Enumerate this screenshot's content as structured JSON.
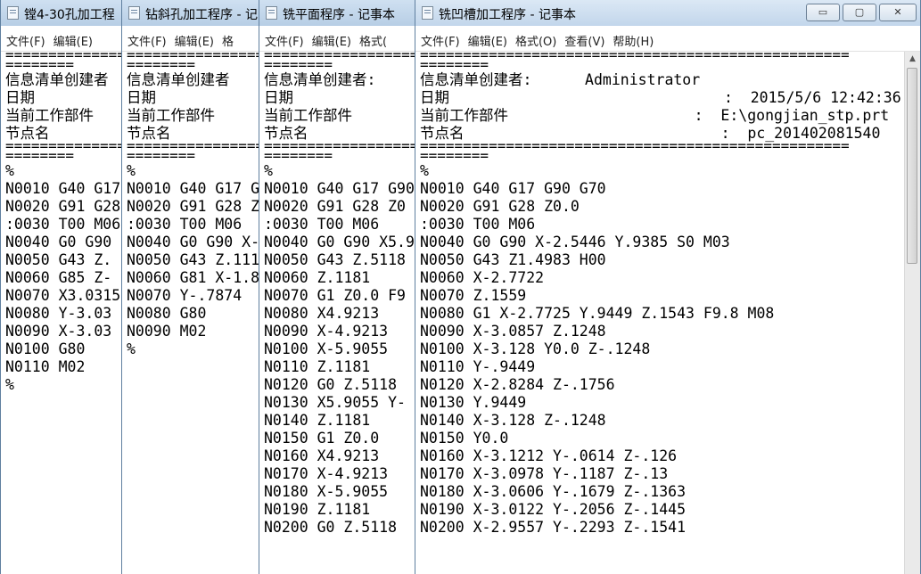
{
  "windows": [
    {
      "title": "镗4-30孔加工程",
      "menu": [
        "文件(F)",
        "编辑(E)"
      ],
      "lines": [
        "==============",
        "========",
        "信息清单创建者",
        "日期",
        "当前工作部件",
        "节点名",
        "==============",
        "========",
        "%",
        "N0010 G40 G17",
        "N0020 G91 G28",
        ":0030 T00 M06",
        "N0040 G0 G90",
        "N0050 G43 Z.",
        "N0060 G85 Z-",
        "N0070 X3.0315",
        "N0080 Y-3.03",
        "N0090 X-3.03",
        "N0100 G80",
        "N0110 M02",
        "%"
      ]
    },
    {
      "title": "钻斜孔加工程序 - 记",
      "menu": [
        "文件(F)",
        "编辑(E)",
        "格"
      ],
      "lines": [
        "====================",
        "========",
        "信息清单创建者",
        "日期",
        "当前工作部件",
        "节点名",
        "====================",
        "========",
        "%",
        "N0010 G40 G17 G",
        "N0020 G91 G28 Z",
        ":0030 T00 M06",
        "N0040 G0 G90 X-",
        "N0050 G43 Z.111",
        "N0060 G81 X-1.8",
        "N0070 Y-.7874",
        "N0080 G80",
        "N0090 M02",
        "%"
      ]
    },
    {
      "title": "铣平面程序 - 记事本",
      "menu": [
        "文件(F)",
        "编辑(E)",
        "格式("
      ],
      "lines": [
        "====================",
        "========",
        "信息清单创建者:",
        "日期",
        "当前工作部件",
        "节点名",
        "====================",
        "========",
        "%",
        "N0010 G40 G17 G90",
        "N0020 G91 G28 Z0",
        ":0030 T00 M06",
        "N0040 G0 G90 X5.9",
        "N0050 G43 Z.5118",
        "N0060 Z.1181",
        "N0070 G1 Z0.0 F9",
        "N0080 X4.9213",
        "N0090 X-4.9213",
        "N0100 X-5.9055",
        "N0110 Z.1181",
        "N0120 G0 Z.5118",
        "N0130 X5.9055 Y-",
        "N0140 Z.1181",
        "N0150 G1 Z0.0",
        "N0160 X4.9213",
        "N0170 X-4.9213",
        "N0180 X-5.9055",
        "N0190 Z.1181",
        "N0200 G0 Z.5118"
      ]
    },
    {
      "title": "铣凹槽加工程序 - 记事本",
      "menu": [
        "文件(F)",
        "编辑(E)",
        "格式(O)",
        "查看(V)",
        "帮助(H)"
      ],
      "controls": {
        "minimize": "▭",
        "maximize": "▢",
        "close": "✕"
      },
      "lines": [
        "==================================================",
        "========",
        "信息清单创建者:      Administrator",
        "日期                               :  2015/5/6 12:42:36",
        "当前工作部件                     :  E:\\gongjian_stp.prt",
        "节点名                             :  pc_201402081540",
        "==================================================",
        "========",
        "%",
        "N0010 G40 G17 G90 G70",
        "N0020 G91 G28 Z0.0",
        ":0030 T00 M06",
        "N0040 G0 G90 X-2.5446 Y.9385 S0 M03",
        "N0050 G43 Z1.4983 H00",
        "N0060 X-2.7722",
        "N0070 Z.1559",
        "N0080 G1 X-2.7725 Y.9449 Z.1543 F9.8 M08",
        "N0090 X-3.0857 Z.1248",
        "N0100 X-3.128 Y0.0 Z-.1248",
        "N0110 Y-.9449",
        "N0120 X-2.8284 Z-.1756",
        "N0130 Y.9449",
        "N0140 X-3.128 Z-.1248",
        "N0150 Y0.0",
        "N0160 X-3.1212 Y-.0614 Z-.126",
        "N0170 X-3.0978 Y-.1187 Z-.13",
        "N0180 X-3.0606 Y-.1679 Z-.1363",
        "N0190 X-3.0122 Y-.2056 Z-.1445",
        "N0200 X-2.9557 Y-.2293 Z-.1541"
      ]
    }
  ]
}
